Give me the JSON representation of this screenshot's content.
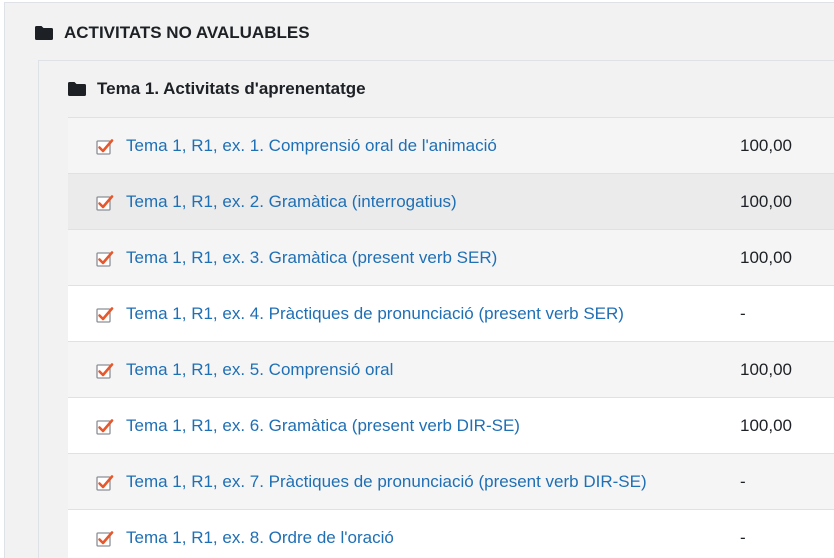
{
  "category": {
    "title": "ACTIVITATS NO AVALUABLES",
    "subcategory": {
      "title": "Tema 1. Activitats d'aprenentatge",
      "items": [
        {
          "label": "Tema 1, R1, ex. 1. Comprensió oral de l'animació",
          "grade": "100,00"
        },
        {
          "label": "Tema 1, R1, ex. 2. Gramàtica (interrogatius)",
          "grade": "100,00"
        },
        {
          "label": "Tema 1, R1, ex. 3. Gramàtica (present verb SER)",
          "grade": "100,00"
        },
        {
          "label": "Tema 1, R1, ex. 4. Pràctiques de pronunciació (present verb SER)",
          "grade": "-"
        },
        {
          "label": "Tema 1, R1, ex. 5. Comprensió oral",
          "grade": "100,00"
        },
        {
          "label": "Tema 1, R1, ex. 6. Gramàtica (present verb DIR-SE)",
          "grade": "100,00"
        },
        {
          "label": "Tema 1, R1, ex. 7. Pràctiques de pronunciació (present verb DIR-SE)",
          "grade": "-"
        },
        {
          "label": "Tema 1, R1, ex. 8. Ordre de l'oració",
          "grade": "-"
        }
      ]
    }
  },
  "icons": {
    "folder": "folder-icon",
    "activity": "quiz-checkbox-icon"
  },
  "colors": {
    "link": "#1f6fb5",
    "text": "#1d2125",
    "icon_check": "#e8572b"
  }
}
